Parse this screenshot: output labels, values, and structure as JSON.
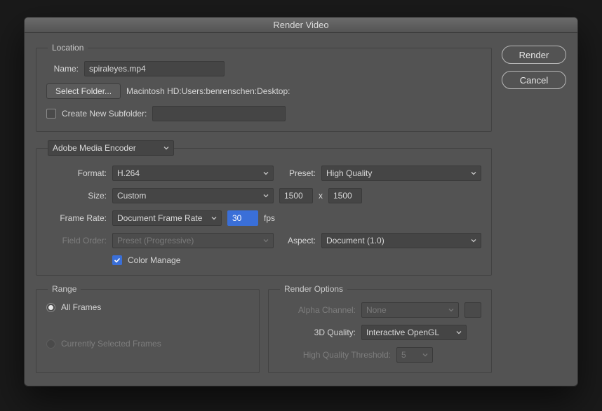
{
  "title": "Render Video",
  "buttons": {
    "render": "Render",
    "cancel": "Cancel"
  },
  "location": {
    "legend": "Location",
    "name_label": "Name:",
    "name_value": "spiraleyes.mp4",
    "select_folder": "Select Folder...",
    "path": "Macintosh HD:Users:benrenschen:Desktop:",
    "create_subfolder_label": "Create New Subfolder:",
    "subfolder_value": ""
  },
  "encoder": {
    "engine": "Adobe Media Encoder",
    "format_label": "Format:",
    "format_value": "H.264",
    "preset_label": "Preset:",
    "preset_value": "High Quality",
    "size_label": "Size:",
    "size_mode": "Custom",
    "size_w": "1500",
    "size_sep": "x",
    "size_h": "1500",
    "framerate_label": "Frame Rate:",
    "framerate_mode": "Document Frame Rate",
    "framerate_value": "30",
    "framerate_unit": "fps",
    "fieldorder_label": "Field Order:",
    "fieldorder_value": "Preset (Progressive)",
    "aspect_label": "Aspect:",
    "aspect_value": "Document (1.0)",
    "color_manage_label": "Color Manage"
  },
  "range": {
    "legend": "Range",
    "all_frames": "All Frames",
    "selected_frames": "Currently Selected Frames"
  },
  "render_options": {
    "legend": "Render Options",
    "alpha_label": "Alpha Channel:",
    "alpha_value": "None",
    "quality3d_label": "3D Quality:",
    "quality3d_value": "Interactive OpenGL",
    "hqthresh_label": "High Quality Threshold:",
    "hqthresh_value": "5"
  }
}
